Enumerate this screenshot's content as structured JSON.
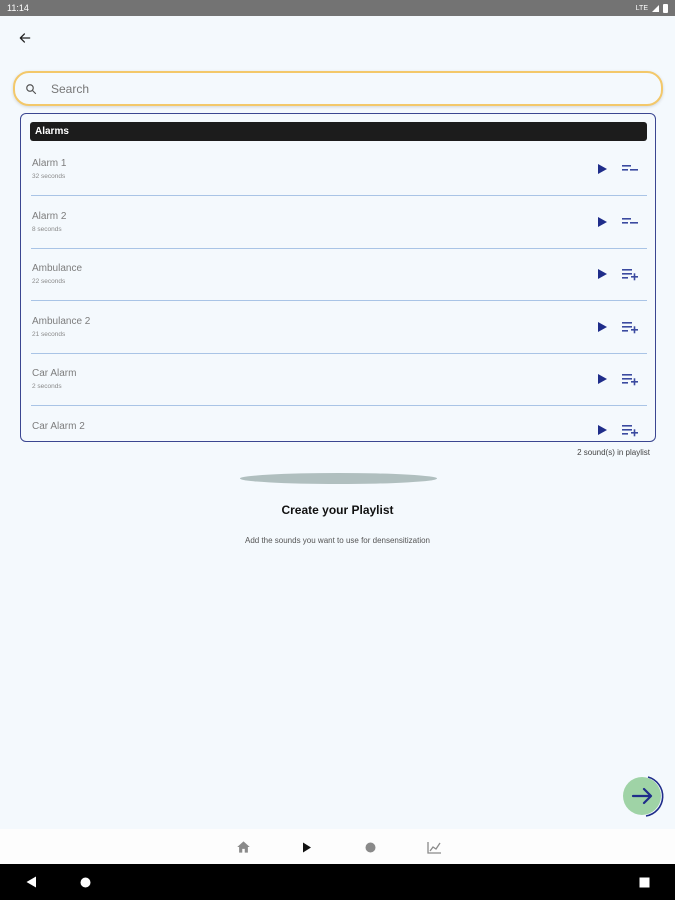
{
  "status_bar": {
    "time": "11:14",
    "network": "LTE"
  },
  "search": {
    "placeholder": "Search",
    "value": ""
  },
  "category": {
    "name": "Alarms"
  },
  "sounds": [
    {
      "title": "Alarm 1",
      "duration": "32 seconds",
      "in_playlist": true
    },
    {
      "title": "Alarm 2",
      "duration": "8 seconds",
      "in_playlist": true
    },
    {
      "title": "Ambulance",
      "duration": "22 seconds",
      "in_playlist": false
    },
    {
      "title": "Ambulance 2",
      "duration": "21 seconds",
      "in_playlist": false
    },
    {
      "title": "Car Alarm",
      "duration": "2 seconds",
      "in_playlist": false
    },
    {
      "title": "Car Alarm 2",
      "duration": "",
      "in_playlist": false
    }
  ],
  "playlist": {
    "count_text": "2 sound(s) in playlist",
    "title": "Create your Playlist",
    "subtitle": "Add the sounds you want to use for densensitization"
  },
  "icons": {
    "back": "arrow-left-icon",
    "search": "search-icon",
    "play": "play-icon",
    "remove": "playlist-remove-icon",
    "add": "playlist-add-icon",
    "next": "arrow-right-icon",
    "home": "home-icon",
    "now_playing": "play-icon",
    "record": "circle-icon",
    "stats": "chart-icon"
  },
  "colors": {
    "accent": "#1f2d8a",
    "search_border": "#f3c86a",
    "fab": "#9fd3a6",
    "background": "#f4f9fd"
  }
}
